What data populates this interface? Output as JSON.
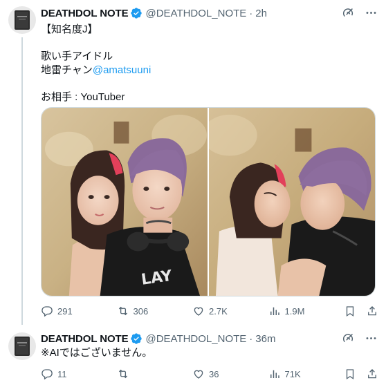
{
  "tweets": [
    {
      "author_name": "DEATHDOL NOTE",
      "handle": "@DEATHDOL_NOTE",
      "separator": "·",
      "time": "2h",
      "lines": [
        "【知名度J】",
        "",
        "歌い手アイドル",
        "地雷チャン",
        "",
        "お相手 : YouTuber"
      ],
      "mention": "@amatsuuni",
      "stats": {
        "replies": "291",
        "reposts": "306",
        "likes": "2.7K",
        "views": "1.9M"
      }
    },
    {
      "author_name": "DEATHDOL NOTE",
      "handle": "@DEATHDOL_NOTE",
      "separator": "·",
      "time": "36m",
      "lines": [
        "※AIではございません。"
      ],
      "stats": {
        "replies": "11",
        "reposts": "",
        "likes": "36",
        "views": "71K"
      }
    }
  ],
  "colors": {
    "accent": "#1d9bf0",
    "muted": "#536471",
    "text": "#0f1419",
    "divider": "#cfd9de"
  },
  "icons": [
    "notebook-avatar-icon",
    "verified-badge-icon",
    "grok-icon",
    "more-icon",
    "reply-icon",
    "repost-icon",
    "like-icon",
    "views-icon",
    "bookmark-icon",
    "share-icon"
  ]
}
